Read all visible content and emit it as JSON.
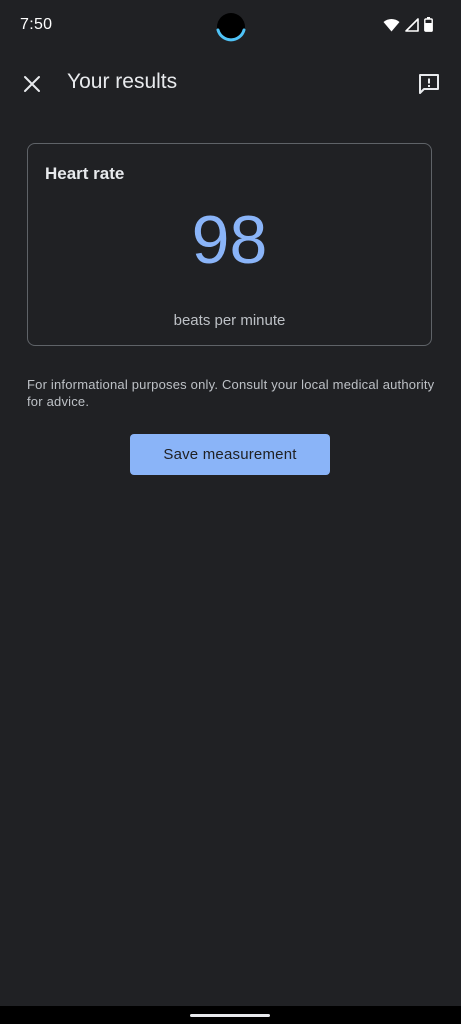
{
  "status_bar": {
    "time": "7:50",
    "icons": [
      "wifi-icon",
      "signal-icon",
      "battery-icon"
    ]
  },
  "app_bar": {
    "title": "Your results",
    "close_icon": "close-icon",
    "feedback_icon": "feedback-icon"
  },
  "result_card": {
    "title": "Heart rate",
    "value": "98",
    "unit": "beats per minute"
  },
  "disclaimer": "For informational purposes only. Consult your local medical authority for advice.",
  "actions": {
    "save_label": "Save measurement"
  },
  "colors": {
    "background": "#202124",
    "accent": "#8ab4f8",
    "card_border": "#5f6368",
    "text_primary": "#e8eaed",
    "text_secondary": "#bdc1c6"
  }
}
